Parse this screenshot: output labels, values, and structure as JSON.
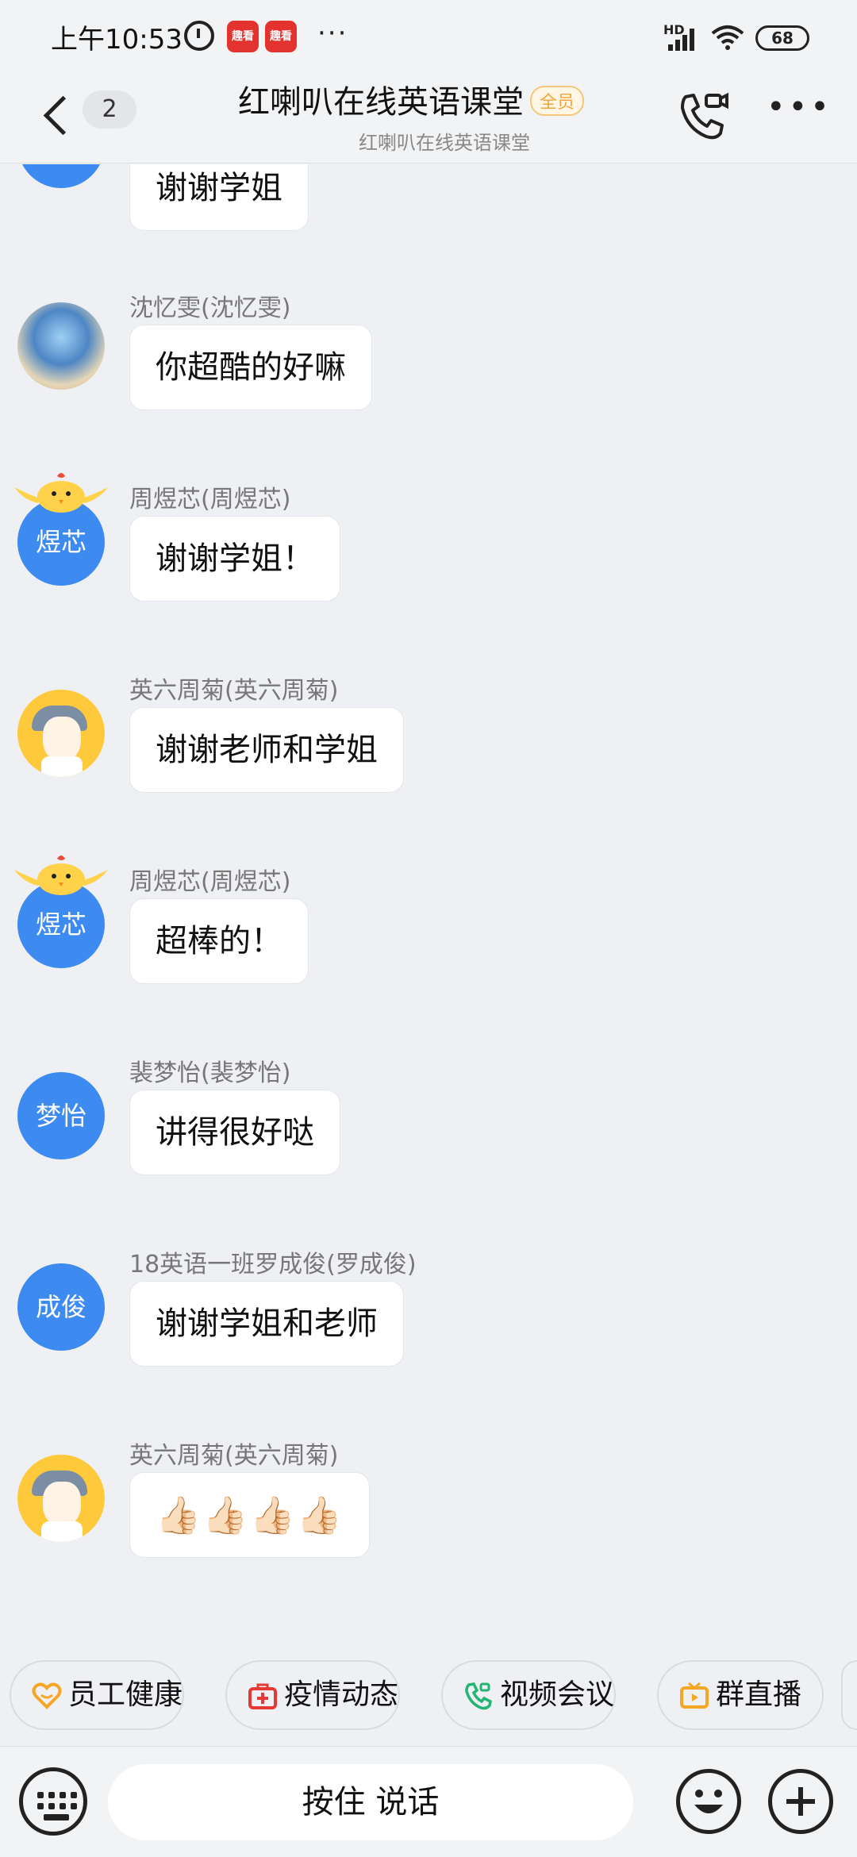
{
  "status_bar": {
    "time": "上午10:53",
    "app_badge_1": "趣看",
    "app_badge_2": "趣看",
    "more_dots": "···",
    "network": "HD",
    "battery": "68"
  },
  "header": {
    "unread_count": "2",
    "title": "红喇叭在线英语课堂",
    "member_badge": "全员",
    "subtitle": "红喇叭在线英语课堂"
  },
  "messages": [
    {
      "name": "",
      "text": "谢谢学姐",
      "avatar_text": "",
      "avatar_type": "blue"
    },
    {
      "name": "沈忆雯(沈忆雯)",
      "text": "你超酷的好嘛",
      "avatar_text": "",
      "avatar_type": "photo"
    },
    {
      "name": "周煜芯(周煜芯)",
      "text": "谢谢学姐！",
      "avatar_text": "煜芯",
      "avatar_type": "blue-chick"
    },
    {
      "name": "英六周菊(英六周菊)",
      "text": "谢谢老师和学姐",
      "avatar_text": "",
      "avatar_type": "cartoon"
    },
    {
      "name": "周煜芯(周煜芯)",
      "text": "超棒的！",
      "avatar_text": "煜芯",
      "avatar_type": "blue-chick"
    },
    {
      "name": "裴梦怡(裴梦怡)",
      "text": "讲得很好哒",
      "avatar_text": "梦怡",
      "avatar_type": "blue"
    },
    {
      "name": "18英语一班罗成俊(罗成俊)",
      "text": "谢谢学姐和老师",
      "avatar_text": "成俊",
      "avatar_type": "blue"
    },
    {
      "name": "英六周菊(英六周菊)",
      "text": "👍🏻👍🏻👍🏻👍🏻",
      "avatar_text": "",
      "avatar_type": "cartoon"
    }
  ],
  "shortcuts": [
    {
      "label": "员工健康",
      "icon": "heart-icon",
      "color": "#f5a623"
    },
    {
      "label": "疫情动态",
      "icon": "medical-kit-icon",
      "color": "#e53935"
    },
    {
      "label": "视频会议",
      "icon": "video-call-icon",
      "color": "#22b573"
    },
    {
      "label": "群直播",
      "icon": "live-tv-icon",
      "color": "#f5a623"
    }
  ],
  "input_bar": {
    "voice_label": "按住 说话"
  },
  "colors": {
    "avatar_blue": "#3d8af0",
    "background": "#eef0f3",
    "badge_orange": "#f2a53c"
  }
}
